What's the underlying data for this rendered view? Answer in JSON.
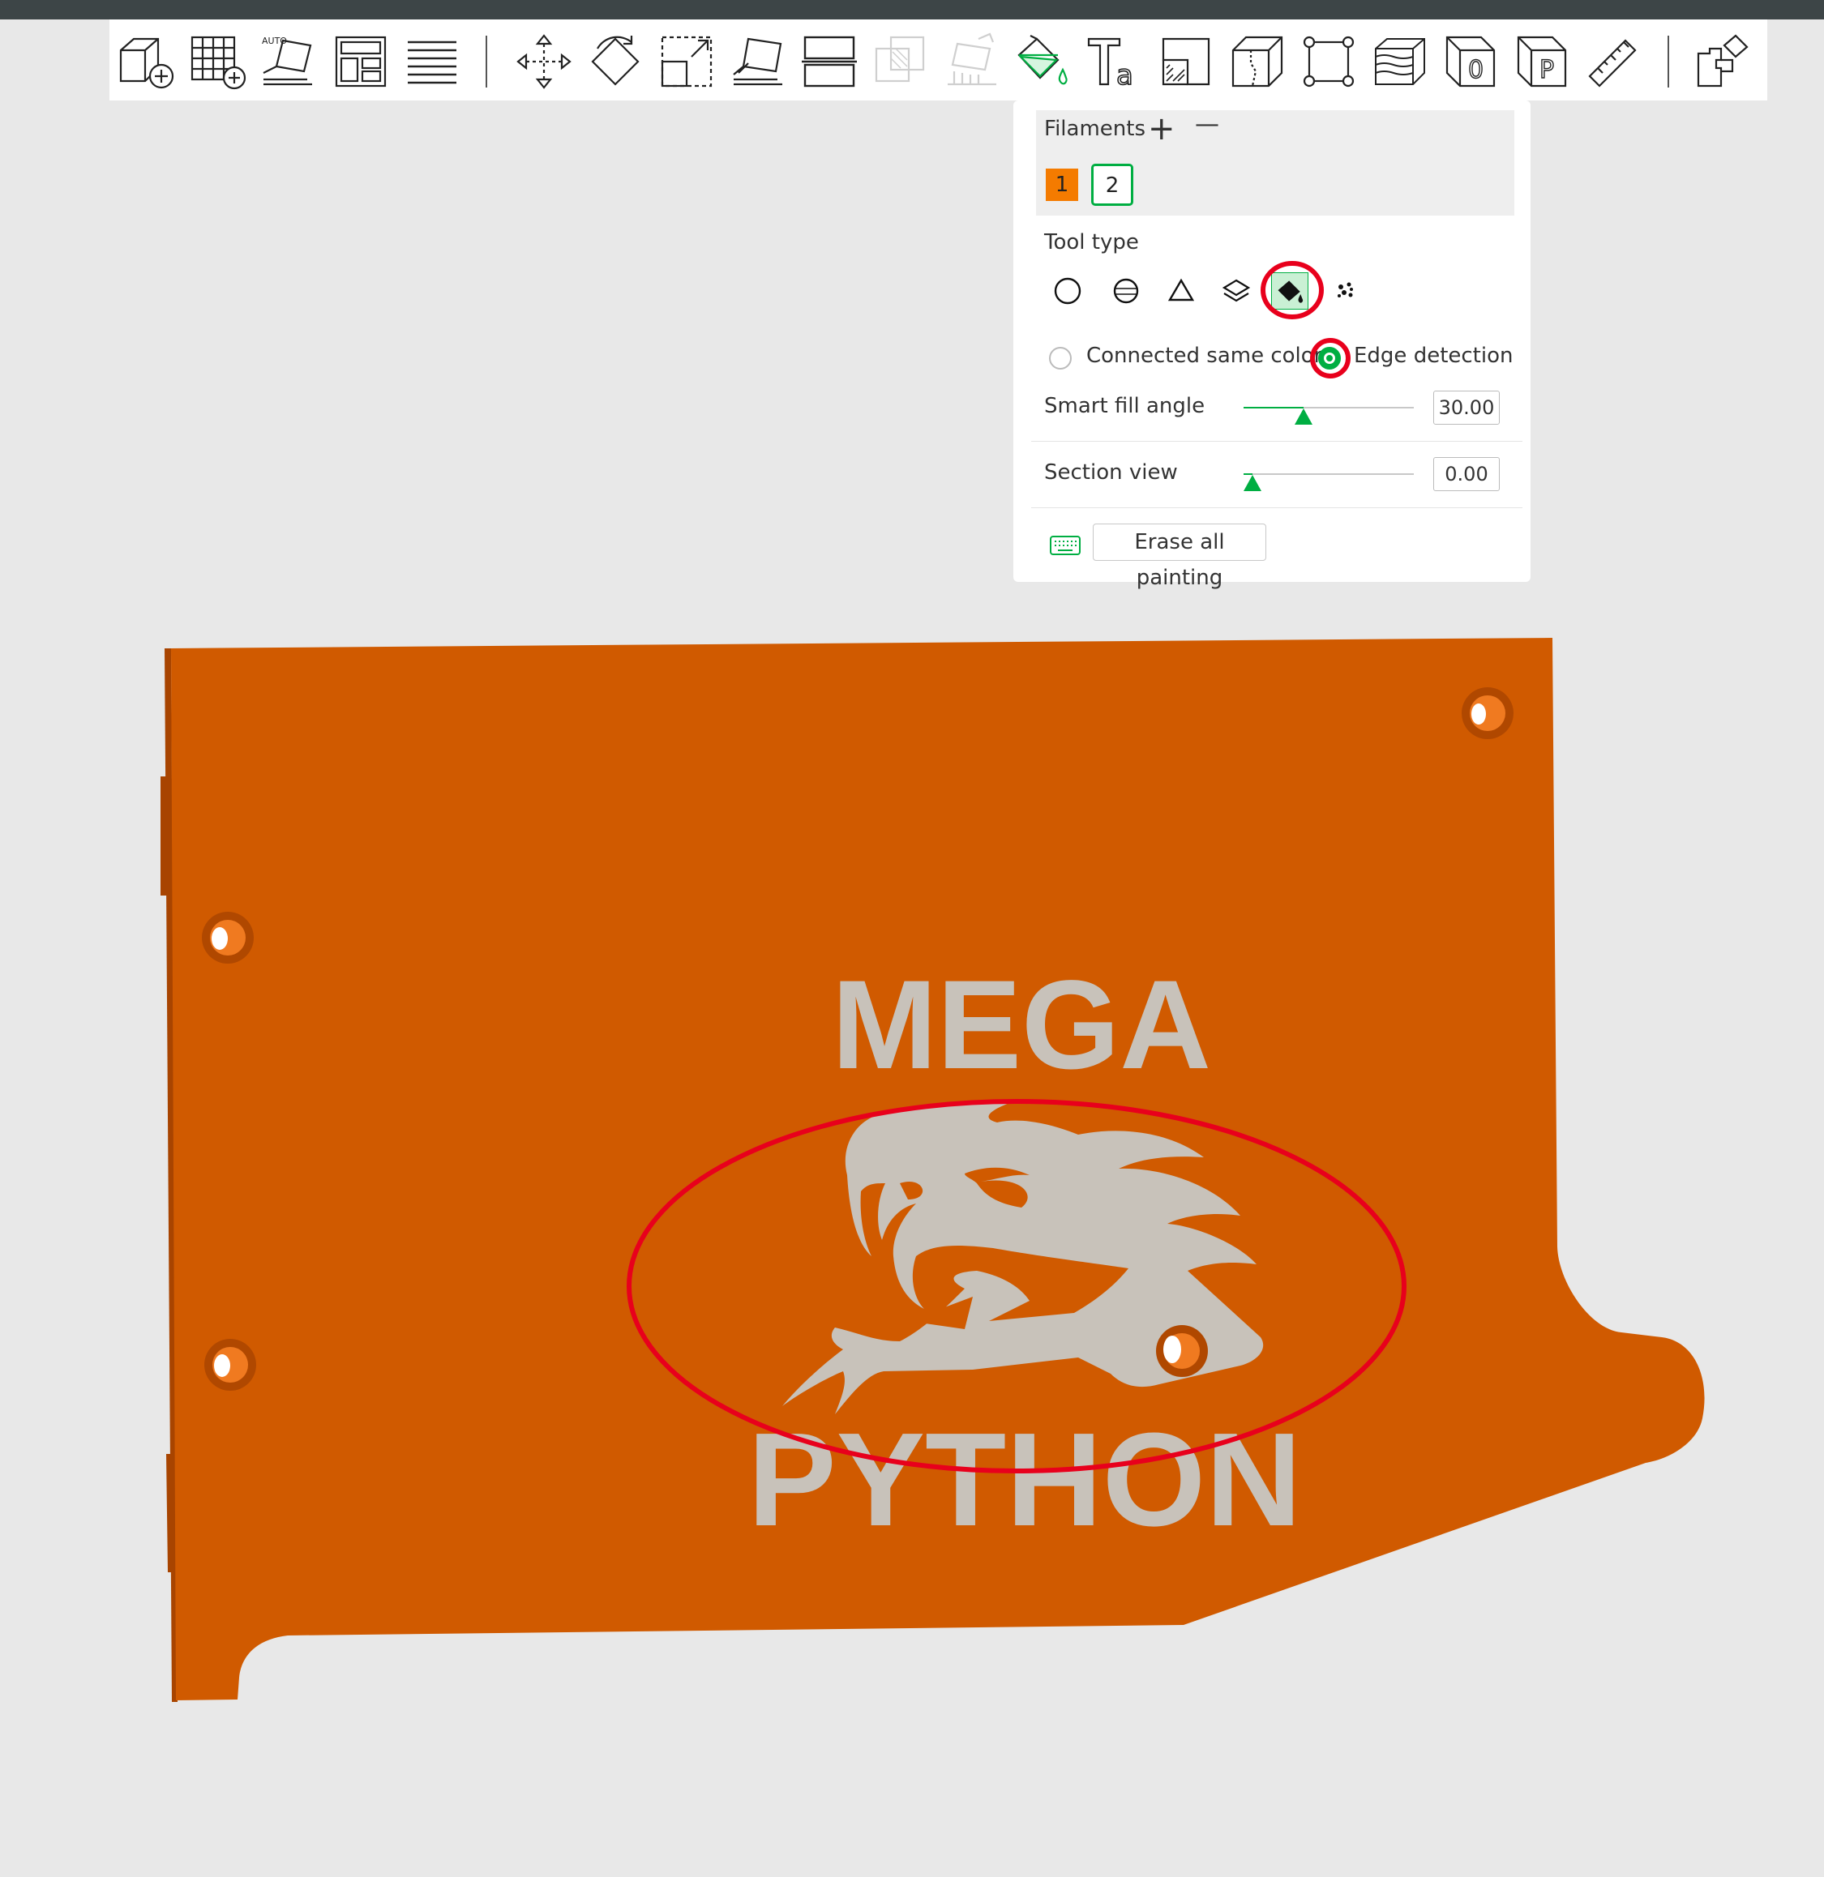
{
  "toolbar": {
    "icons": [
      "add-object-icon",
      "add-plate-icon",
      "auto-orient-icon",
      "arrange-icon",
      "layers-list-icon",
      "move-icon",
      "rotate-icon",
      "scale-icon",
      "lay-on-face-icon",
      "cut-icon",
      "boolean-icon",
      "support-paint-icon",
      "color-paint-icon",
      "text-icon",
      "emboss-icon",
      "assembly-icon",
      "corner-fit-icon",
      "variable-layer-icon",
      "seam-icon",
      "brim-icon",
      "measure-icon",
      "assembly-view-icon"
    ],
    "auto_label": "AUTO"
  },
  "panel": {
    "filaments_label": "Filaments",
    "add_symbol": "+",
    "remove_symbol": "—",
    "filament_1": "1",
    "filament_2": "2",
    "filament_1_color": "#f47b00",
    "filament_2_border": "#00ae42",
    "tool_type_label": "Tool type",
    "tools": [
      "circle-tool-icon",
      "sphere-tool-icon",
      "triangle-tool-icon",
      "height-range-icon",
      "fill-bucket-icon",
      "gap-fill-icon"
    ],
    "selected_tool": "fill-bucket-icon",
    "mode_connected": "Connected same color",
    "mode_edge": "Edge detection",
    "selected_mode": "Edge detection",
    "smart_fill_label": "Smart fill angle",
    "smart_fill_value": "30.00",
    "smart_fill_fraction": 0.35,
    "section_view_label": "Section view",
    "section_view_value": "0.00",
    "section_view_fraction": 0.05,
    "erase_button": "Erase all painting",
    "accent": "#00ae42",
    "highlight_color": "#e8001c"
  },
  "model": {
    "text_top": "MEGA",
    "text_bottom": "PYTHON",
    "plate_color": "#d05a00",
    "paint_color": "#c8c2ba"
  }
}
